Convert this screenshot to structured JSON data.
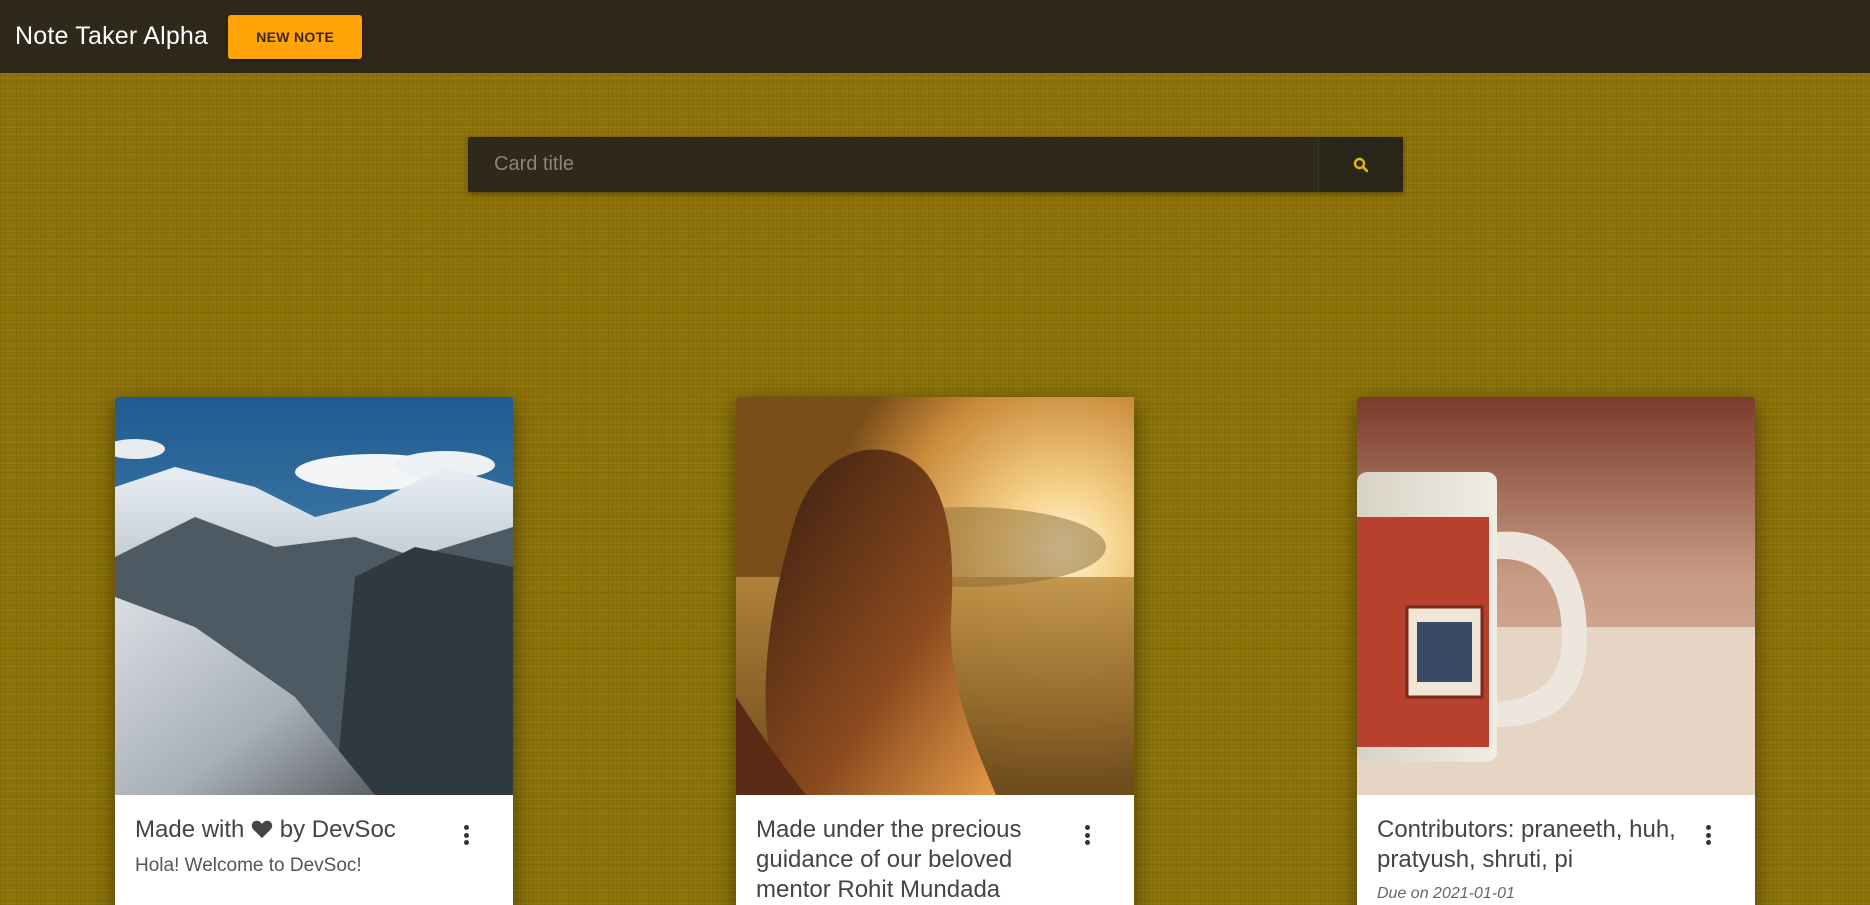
{
  "navbar": {
    "brand": "Note Taker Alpha",
    "new_note_label": "NEW NOTE"
  },
  "search": {
    "placeholder": "Card title",
    "icon": "search-icon"
  },
  "colors": {
    "navbar_bg": "#2f291c",
    "accent": "#ffa306",
    "page_bg": "#8f7406",
    "search_icon": "#e5b800"
  },
  "cards": [
    {
      "image": "snowy-mountains-photo",
      "title_prefix": "Made with",
      "title_icon": "heart-icon",
      "title_suffix": "by DevSoc",
      "text": "Hola! Welcome to DevSoc!",
      "menu_icon": "more-vert-icon"
    },
    {
      "image": "woman-sunset-field-photo",
      "title": "Made under the precious guidance of our beloved mentor Rohit Mundada",
      "menu_icon": "more-vert-icon"
    },
    {
      "image": "coffee-mug-photo",
      "title": "Contributors: praneeth, huh, pratyush, shruti, pi",
      "due": "Due on 2021-01-01",
      "menu_icon": "more-vert-icon"
    }
  ]
}
